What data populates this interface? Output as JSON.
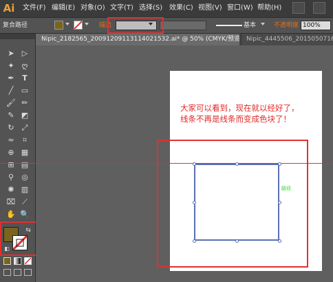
{
  "app": {
    "logo": "Ai"
  },
  "menu": [
    "文件(F)",
    "编辑(E)",
    "对象(O)",
    "文字(T)",
    "选择(S)",
    "效果(C)",
    "视图(V)",
    "窗口(W)",
    "帮助(H)"
  ],
  "control_bar": {
    "object_type": "复合路径",
    "stroke_label": "描边",
    "stroke_style": "基本",
    "opacity_label": "不透明度",
    "opacity_value": "100%"
  },
  "tabs": [
    {
      "label": "Nipic_2182565_20091209113114021532.ai* @ 50% (CMYK/预览)",
      "close": "×",
      "active": true
    },
    {
      "label": "Nipic_4445506_2015050716",
      "active": false
    }
  ],
  "annotation": {
    "line1": "大家可以看到，现在就以经好了，",
    "line2": "线条不再是线条而变成色块了！"
  },
  "path_label": "路径",
  "colors": {
    "fill": "#7a6520",
    "stroke_highlight": "#e03030",
    "selection": "#5a6fb3"
  },
  "tool_icons": [
    "selection-icon",
    "direct-selection-icon",
    "magic-wand-icon",
    "lasso-icon",
    "pen-icon",
    "type-icon",
    "line-icon",
    "rectangle-icon",
    "paintbrush-icon",
    "pencil-icon",
    "blob-brush-icon",
    "eraser-icon",
    "rotate-icon",
    "scale-icon",
    "width-icon",
    "free-transform-icon",
    "shape-builder-icon",
    "perspective-grid-icon",
    "mesh-icon",
    "gradient-icon",
    "eyedropper-icon",
    "blend-icon",
    "symbol-sprayer-icon",
    "column-graph-icon",
    "artboard-icon",
    "slice-icon",
    "hand-icon",
    "zoom-icon"
  ]
}
